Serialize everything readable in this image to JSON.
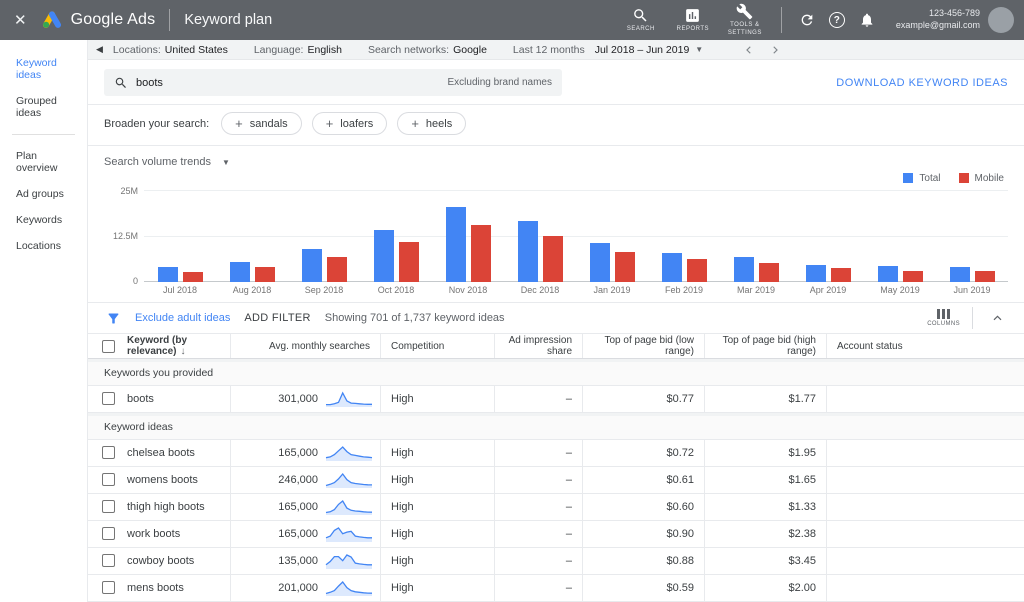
{
  "topbar": {
    "close_label": "✕",
    "brand": "Google Ads",
    "page_title": "Keyword plan",
    "nav": [
      {
        "label": "SEARCH"
      },
      {
        "label": "REPORTS"
      },
      {
        "label": "TOOLS & SETTINGS"
      }
    ],
    "account": {
      "id": "123-456-789",
      "email": "example@gmail.com"
    }
  },
  "sidebar": {
    "items": [
      {
        "label": "Keyword ideas",
        "active": true
      },
      {
        "label": "Grouped ideas"
      },
      {
        "divider": true
      },
      {
        "label": "Plan overview"
      },
      {
        "label": "Ad groups"
      },
      {
        "label": "Keywords"
      },
      {
        "label": "Locations"
      }
    ]
  },
  "toolbar": {
    "locations_label": "Locations:",
    "locations_value": "United States",
    "language_label": "Language:",
    "language_value": "English",
    "networks_label": "Search networks:",
    "networks_value": "Google",
    "range_label": "Last 12 months",
    "range_value": "Jul 2018 – Jun 2019"
  },
  "search": {
    "query": "boots",
    "excluding": "Excluding brand names",
    "download_label": "DOWNLOAD KEYWORD IDEAS"
  },
  "broaden": {
    "label": "Broaden your search:",
    "chips": [
      "sandals",
      "loafers",
      "heels"
    ]
  },
  "chart_data": {
    "type": "bar",
    "title": "Search volume trends",
    "categories": [
      "Jul 2018",
      "Aug 2018",
      "Sep 2018",
      "Oct 2018",
      "Nov 2018",
      "Dec 2018",
      "Jan 2019",
      "Feb 2019",
      "Mar 2019",
      "Apr 2019",
      "May 2019",
      "Jun 2019"
    ],
    "series": [
      {
        "name": "Total",
        "color": "#4285f4",
        "values_millions": [
          4.0,
          5.5,
          9.0,
          14.2,
          20.3,
          16.5,
          10.5,
          7.9,
          6.8,
          4.7,
          4.4,
          4.1
        ]
      },
      {
        "name": "Mobile",
        "color": "#db4437",
        "values_millions": [
          2.8,
          4.1,
          6.8,
          10.8,
          15.5,
          12.6,
          8.2,
          6.3,
          5.2,
          3.7,
          3.1,
          2.9
        ]
      }
    ],
    "ylabel": "",
    "xlabel": "",
    "ylim_millions": [
      0,
      25
    ],
    "yticks": [
      "25M",
      "12.5M",
      "0"
    ],
    "grid": true,
    "legend_position": "top-right"
  },
  "filter_bar": {
    "exclude_link": "Exclude adult ideas",
    "add_filter": "ADD FILTER",
    "showing": "Showing 701 of 1,737 keyword ideas",
    "columns_label": "COLUMNS"
  },
  "table": {
    "headers": [
      "Keyword (by relevance)",
      "Avg. monthly searches",
      "Competition",
      "Ad impression share",
      "Top of page bid (low range)",
      "Top of page bid (high range)",
      "Account status"
    ],
    "sections": [
      {
        "label": "Keywords you provided",
        "rows": [
          {
            "keyword": "boots",
            "avg_monthly_searches": "301,000",
            "competition": "High",
            "ad_impression_share": "–",
            "bid_low": "$0.77",
            "bid_high": "$1.77",
            "account_status": "",
            "trend": [
              1,
              1,
              1.5,
              2.5,
              9,
              3.5,
              2,
              1.8,
              1.5,
              1.3,
              1.2,
              1.2
            ]
          }
        ]
      },
      {
        "label": "Keyword ideas",
        "rows": [
          {
            "keyword": "chelsea boots",
            "avg_monthly_searches": "165,000",
            "competition": "High",
            "ad_impression_share": "–",
            "bid_low": "$0.72",
            "bid_high": "$1.95",
            "account_status": "",
            "trend": [
              1.5,
              2,
              3.5,
              6,
              8.5,
              5.5,
              3.5,
              3,
              2.5,
              2,
              1.8,
              1.6
            ]
          },
          {
            "keyword": "womens boots",
            "avg_monthly_searches": "246,000",
            "competition": "High",
            "ad_impression_share": "–",
            "bid_low": "$0.61",
            "bid_high": "$1.65",
            "account_status": "",
            "trend": [
              1,
              1.8,
              3,
              5.5,
              8.8,
              5,
              3,
              2.4,
              2,
              1.7,
              1.5,
              1.4
            ]
          },
          {
            "keyword": "thigh high boots",
            "avg_monthly_searches": "165,000",
            "competition": "High",
            "ad_impression_share": "–",
            "bid_low": "$0.60",
            "bid_high": "$1.33",
            "account_status": "",
            "trend": [
              1,
              1.5,
              3,
              6.5,
              8.8,
              4,
              2.5,
              2,
              1.8,
              1.5,
              1.3,
              1.2
            ]
          },
          {
            "keyword": "work boots",
            "avg_monthly_searches": "165,000",
            "competition": "High",
            "ad_impression_share": "–",
            "bid_low": "$0.90",
            "bid_high": "$2.38",
            "account_status": "",
            "trend": [
              2,
              3,
              6.5,
              8,
              4.5,
              5.5,
              6,
              3,
              2.5,
              2.2,
              2,
              2
            ]
          },
          {
            "keyword": "cowboy boots",
            "avg_monthly_searches": "135,000",
            "competition": "High",
            "ad_impression_share": "–",
            "bid_low": "$0.88",
            "bid_high": "$3.45",
            "account_status": "",
            "trend": [
              2,
              4,
              7,
              7,
              4.5,
              8,
              6.8,
              3,
              2.5,
              2.2,
              2,
              2
            ]
          },
          {
            "keyword": "mens boots",
            "avg_monthly_searches": "201,000",
            "competition": "High",
            "ad_impression_share": "–",
            "bid_low": "$0.59",
            "bid_high": "$2.00",
            "account_status": "",
            "trend": [
              1,
              1.8,
              3,
              6,
              8.8,
              5,
              3,
              2.2,
              1.8,
              1.5,
              1.3,
              1.2
            ]
          }
        ]
      }
    ]
  }
}
